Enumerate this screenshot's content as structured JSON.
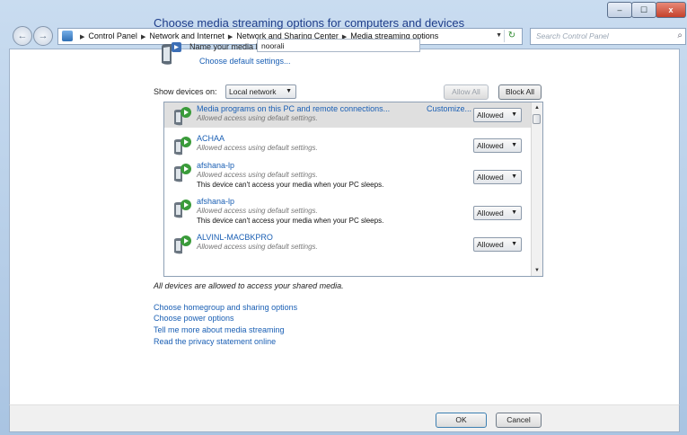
{
  "titlebar": {
    "minimize": "–",
    "maximize": "☐",
    "close": "x"
  },
  "address": {
    "back_glyph": "←",
    "forward_glyph": "→",
    "crumbs": [
      "Control Panel",
      "Network and Internet",
      "Network and Sharing Center",
      "Media streaming options"
    ],
    "separator": "▶",
    "dropdown_glyph": "▼",
    "refresh_glyph": "↻",
    "icon": "control-panel-icon"
  },
  "search": {
    "placeholder": "Search Control Panel",
    "icon_glyph": "⌕"
  },
  "page": {
    "title": "Choose media streaming options for computers and devices",
    "library_label": "Name your media library:",
    "library_value": "noorali",
    "default_settings_link": "Choose default settings...",
    "show_devices_label": "Show devices on:",
    "show_devices_value": "Local network",
    "allow_all": "Allow All",
    "block_all": "Block All",
    "all_devices_note": "All devices are allowed to access your shared media."
  },
  "devices": [
    {
      "name": "Media programs on this PC and remote connections...",
      "status": "Allowed access using default settings.",
      "note": "",
      "customize": "Customize...",
      "access": "Allowed",
      "selected": true
    },
    {
      "name": "ACHAA",
      "status": "Allowed access using default settings.",
      "note": "",
      "customize": "",
      "access": "Allowed",
      "selected": false
    },
    {
      "name": "afshana-lp",
      "status": "Allowed access using default settings.",
      "note": "This device can't access your media when your PC sleeps.",
      "customize": "",
      "access": "Allowed",
      "selected": false
    },
    {
      "name": "afshana-lp",
      "status": "Allowed access using default settings.",
      "note": "This device can't access your media when your PC sleeps.",
      "customize": "",
      "access": "Allowed",
      "selected": false
    },
    {
      "name": "ALVINL-MACBKPRO",
      "status": "Allowed access using default settings.",
      "note": "",
      "customize": "",
      "access": "Allowed",
      "selected": false
    }
  ],
  "dropdown_glyph": "▼",
  "scroll": {
    "up": "▲",
    "down": "▼"
  },
  "links": [
    "Choose homegroup and sharing options",
    "Choose power options",
    "Tell me more about media streaming",
    "Read the privacy statement online"
  ],
  "footer": {
    "ok": "OK",
    "cancel": "Cancel"
  },
  "colors": {
    "link": "#1a5fb4",
    "heading": "#1e3d8a",
    "chrome": "#c9dcf0"
  }
}
